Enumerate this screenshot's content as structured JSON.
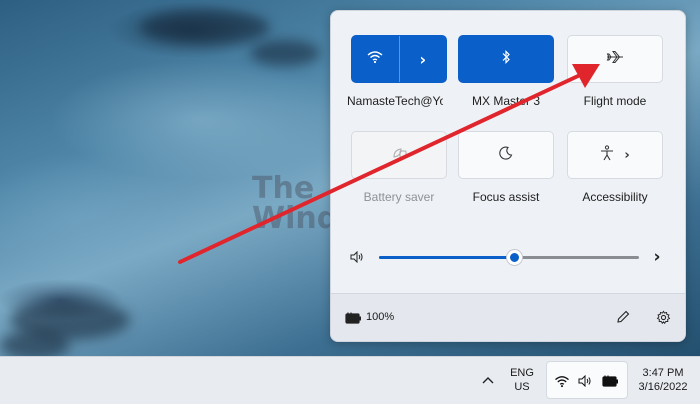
{
  "quick_settings": {
    "tiles": [
      {
        "label": "NamasteTech@Yo",
        "state": "on",
        "icon": "wifi-icon",
        "has_expand": true
      },
      {
        "label": "MX Master 3",
        "state": "on",
        "icon": "bluetooth-icon"
      },
      {
        "label": "Flight mode",
        "state": "off",
        "icon": "airplane-icon"
      },
      {
        "label": "Battery saver",
        "state": "disabled",
        "icon": "battery-saver-icon"
      },
      {
        "label": "Focus assist",
        "state": "off",
        "icon": "moon-icon"
      },
      {
        "label": "Accessibility",
        "state": "off",
        "icon": "accessibility-icon",
        "has_expand": true
      }
    ],
    "volume": {
      "level": 0.52,
      "icon": "speaker-icon",
      "expand_icon": "chevron-right-icon"
    },
    "footer": {
      "battery_percent": "100%",
      "battery_icon": "battery-charging-icon",
      "edit_icon": "pencil-icon",
      "settings_icon": "gear-icon"
    }
  },
  "watermark": {
    "line1": "The",
    "line2": "WindowsClub"
  },
  "taskbar": {
    "language_line1": "ENG",
    "language_line2": "US",
    "overflow_icon": "chevron-up-icon",
    "tray_icons": [
      "wifi-icon",
      "speaker-icon",
      "battery-charging-icon"
    ],
    "time": "3:47 PM",
    "date": "3/16/2022"
  },
  "colors": {
    "accent": "#0a5fc8",
    "arrow": "#e0262c",
    "panel_bg": "#eef1f6"
  }
}
